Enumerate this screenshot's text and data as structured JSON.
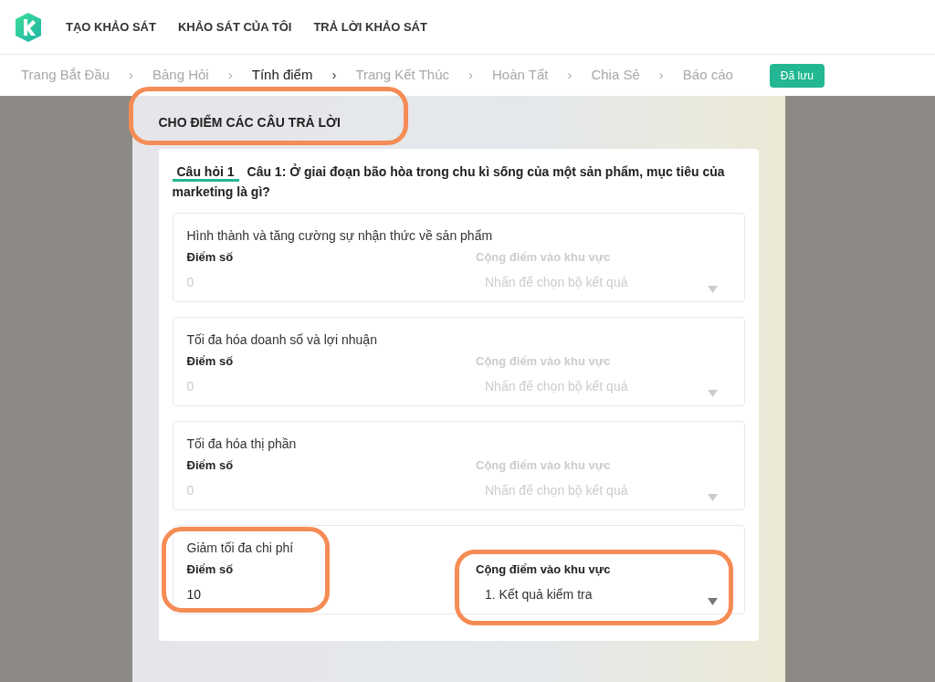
{
  "nav": {
    "items": [
      "TẠO KHẢO SÁT",
      "KHẢO SÁT CỦA TÔI",
      "TRẢ LỜI KHẢO SÁT"
    ]
  },
  "steps": [
    {
      "label": "Trang Bắt Đầu",
      "selected": false
    },
    {
      "label": "Bảng Hỏi",
      "selected": false
    },
    {
      "label": "Tính điểm",
      "selected": true
    },
    {
      "label": "Trang Kết Thúc",
      "selected": false
    },
    {
      "label": "Hoàn Tất",
      "selected": false
    },
    {
      "label": "Chia Sẻ",
      "selected": false
    },
    {
      "label": "Báo cáo",
      "selected": false
    }
  ],
  "separator": "›",
  "save_badge": "Đã lưu",
  "section": {
    "title": "CHO ĐIỂM CÁC CÂU TRẢ LỜI",
    "highlighted": true
  },
  "question": {
    "tab": "Câu hỏi 1",
    "text": "Câu 1: Ở giai đoạn bão hòa trong chu kì sống của một sản phẩm, mục tiêu của marketing là gì?"
  },
  "answers": [
    {
      "text": "Hình thành và tăng cường sự nhận thức về sản phẩm",
      "score_label": "Điểm số",
      "score": "0",
      "region_label": "Cộng điểm vào khu vực",
      "region_placeholder": "Nhấn để chọn bộ kết quả",
      "active": false,
      "score_highlighted": false,
      "region_highlighted": false
    },
    {
      "text": "Tối đa hóa doanh số và lợi nhuận",
      "score_label": "Điểm số",
      "score": "0",
      "region_label": "Cộng điểm vào khu vực",
      "region_placeholder": "Nhấn để chọn bộ kết quả",
      "active": false,
      "score_highlighted": false,
      "region_highlighted": false
    },
    {
      "text": "Tối đa hóa thị phần",
      "score_label": "Điểm số",
      "score": "0",
      "region_label": "Cộng điểm vào khu vực",
      "region_placeholder": "Nhấn để chọn bộ kết quả",
      "active": false,
      "score_highlighted": false,
      "region_highlighted": false
    },
    {
      "text": "Giảm tối đa chi phí",
      "score_label": "Điểm số",
      "score": "10",
      "region_label": "Cộng điểm vào khu vực",
      "region_value": "1. Kết quả kiểm tra",
      "active": true,
      "score_highlighted": true,
      "region_highlighted": true
    }
  ]
}
